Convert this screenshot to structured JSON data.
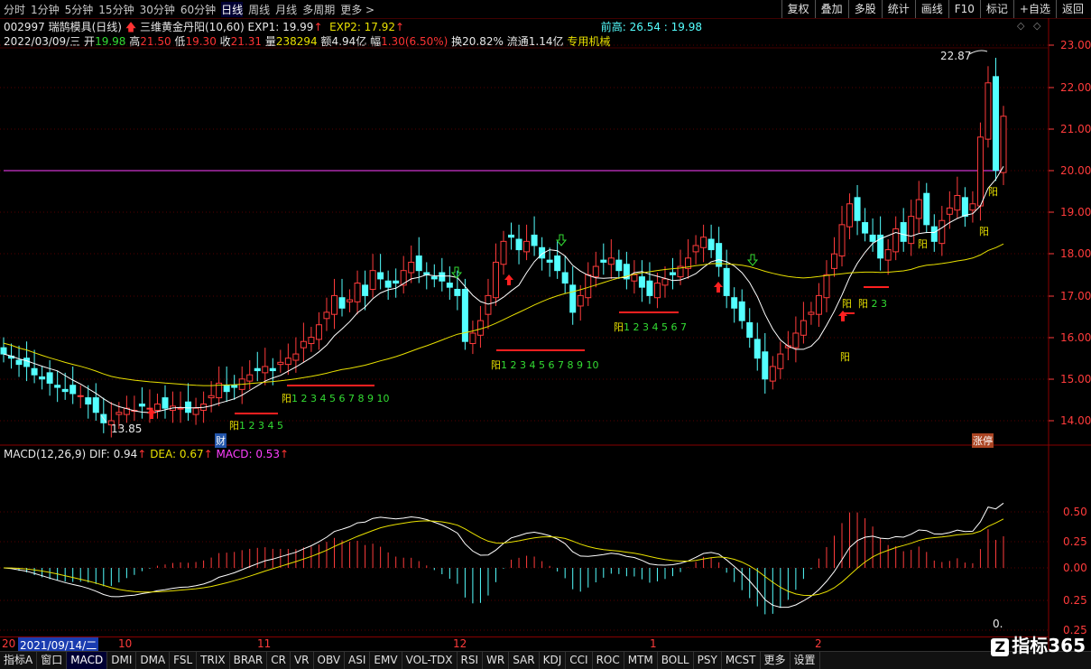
{
  "period_tabs": [
    "分时",
    "1分钟",
    "5分钟",
    "15分钟",
    "30分钟",
    "60分钟",
    "日线",
    "周线",
    "月线",
    "多周期",
    "更多 >"
  ],
  "active_period": "日线",
  "right_buttons": [
    "复权",
    "叠加",
    "多股",
    "统计",
    "画线",
    "F10",
    "标记",
    "+自选",
    "返回"
  ],
  "header": {
    "code_name": "002997 瑞鹄模具(日线)",
    "indicator_name": "三维黄金丹阳(10,60)",
    "exp1": "EXP1: 19.99",
    "exp2": "EXP2: 17.92",
    "prev_high": "前高: 26.54 : 19.98"
  },
  "quote": {
    "date": "2022/03/09/三",
    "open_label": "开",
    "open": "19.98",
    "high_label": "高",
    "high": "21.50",
    "low_label": "低",
    "low": "19.30",
    "close_label": "收",
    "close": "21.31",
    "vol_label": "量",
    "vol": "238294",
    "amount_label": "额",
    "amount": "4.94亿",
    "change_label": "幅",
    "change": "1.30(6.50%)",
    "turnover_label": "换",
    "turnover": "20.82%",
    "float_label": "流通",
    "float": "1.14亿",
    "sector": "专用机械"
  },
  "price_axis": [
    "23.00",
    "22.00",
    "21.00",
    "20.00",
    "19.00",
    "18.00",
    "17.00",
    "16.00",
    "15.00",
    "14.00"
  ],
  "macd_axis": [
    "0.50",
    "0.25",
    "0.00",
    "0.25",
    "0.25"
  ],
  "macd_info": {
    "name": "MACD(12,26,9)",
    "dif": "DIF: 0.94",
    "dea": "DEA: 0.67",
    "macd": "MACD: 0.53"
  },
  "annotations": {
    "max_price": "22.87",
    "min_price": "13.85",
    "cai": "财",
    "zhangting": "涨停",
    "zero": "0."
  },
  "signals": [
    {
      "text": "阳1 2 3 4 5"
    },
    {
      "text": "阳1 2 3 4 5 6 7 8 9 10"
    },
    {
      "text": "阳1 2 3 4 5 6 7 8 9 10"
    },
    {
      "text": "阳1 2 3 4 5 6 7"
    },
    {
      "text": "阳"
    },
    {
      "text": "阳"
    },
    {
      "text": "阳 2 3"
    },
    {
      "text": "阳"
    },
    {
      "text": "阳"
    },
    {
      "text": "阳"
    }
  ],
  "time_axis": {
    "cursor_date": "2021/09/14/二",
    "left_clip": "20",
    "months": [
      "10",
      "11",
      "12",
      "1",
      "2"
    ]
  },
  "indicator_tabs": [
    "指标A",
    "窗口",
    "MACD",
    "DMI",
    "DMA",
    "FSL",
    "TRIX",
    "BRAR",
    "CR",
    "VR",
    "OBV",
    "ASI",
    "EMV",
    "VOL-TDX",
    "RSI",
    "WR",
    "SAR",
    "KDJ",
    "CCI",
    "ROC",
    "MTM",
    "BOLL",
    "PSY",
    "MCST",
    "更多",
    "设置"
  ],
  "active_indicator": "MACD",
  "brand": "指标365",
  "colors": {
    "up": "#ff3b3b",
    "down": "#54ffff",
    "ma_short": "#ffffff",
    "ma_long": "#e8e000",
    "dea": "#e8e000",
    "baseline": "#ff40ff"
  }
}
